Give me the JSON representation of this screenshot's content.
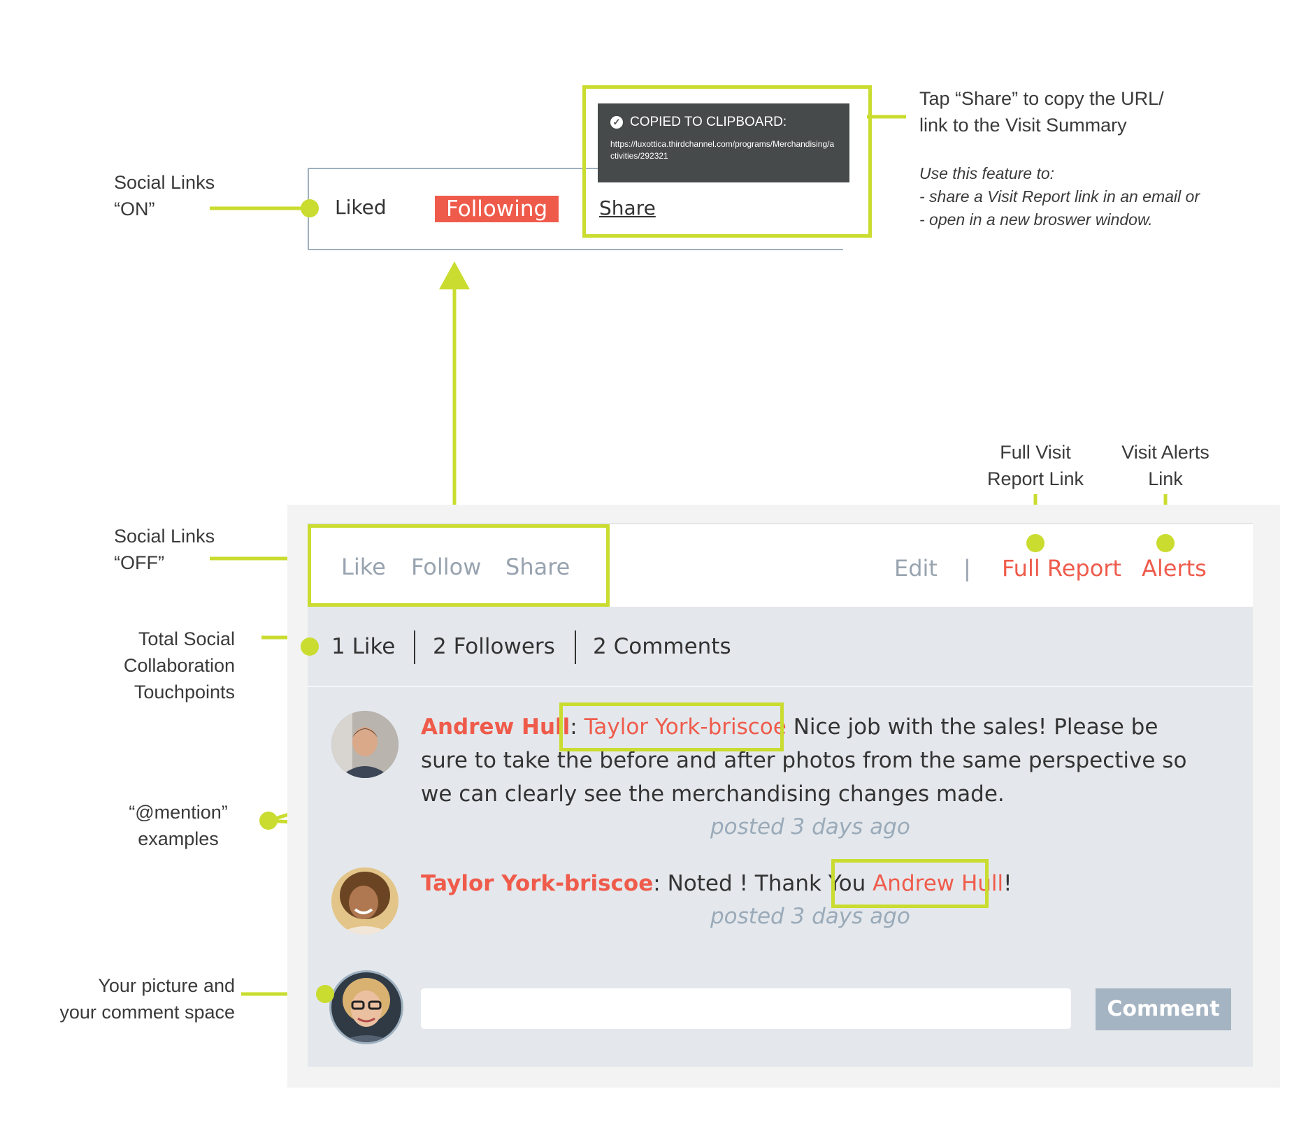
{
  "annotations": {
    "social_on": [
      "Social Links",
      "“ON”"
    ],
    "social_off": [
      "Social Links",
      "“OFF”"
    ],
    "share_tip": [
      "Tap “Share” to copy the URL/",
      "link to the Visit Summary"
    ],
    "share_use": [
      "Use this feature to:",
      "- share a Visit Report link in an email or",
      "- open in a new broswer window."
    ],
    "full_report": [
      "Full Visit",
      "Report Link"
    ],
    "alerts": [
      "Visit Alerts",
      "Link"
    ],
    "touchpoints": [
      "Total Social",
      "Collaboration",
      "Touchpoints"
    ],
    "mention": [
      "“@mention”",
      "examples"
    ],
    "your_picture": [
      "Your picture and",
      "your comment space"
    ]
  },
  "social_bar_on": {
    "liked": "Liked",
    "following": "Following",
    "share": "Share"
  },
  "clipboard": {
    "title": "COPIED TO CLIPBOARD:",
    "url": "https://luxottica.thirdchannel.com/programs/Merchandising/activities/292321"
  },
  "social_bar_off": {
    "like": "Like",
    "follow": "Follow",
    "share": "Share",
    "edit": "Edit",
    "separator": "|",
    "full_report": "Full Report",
    "alerts": "Alerts"
  },
  "stats": {
    "likes": "1 Like",
    "followers": "2 Followers",
    "comments": "2 Comments"
  },
  "comments": [
    {
      "author": "Andrew Hull",
      "colon": ":",
      "mention": "Taylor York-briscoe",
      "text_after": " Nice job with the sales! Please be sure to take the before and after photos from the same perspective so we can clearly see the merchandising changes made.",
      "time": "posted 3 days ago"
    },
    {
      "author": "Taylor York-briscoe",
      "text_mid": ": Noted ! Thank You ",
      "mention": "Andrew Hull",
      "text_end": "!",
      "time": "posted 3 days ago"
    }
  ],
  "composer": {
    "button": "Comment",
    "placeholder": ""
  },
  "colors": {
    "accent": "#c9dc2f",
    "red": "#ef5b4b",
    "panel": "#e4e8ec"
  }
}
